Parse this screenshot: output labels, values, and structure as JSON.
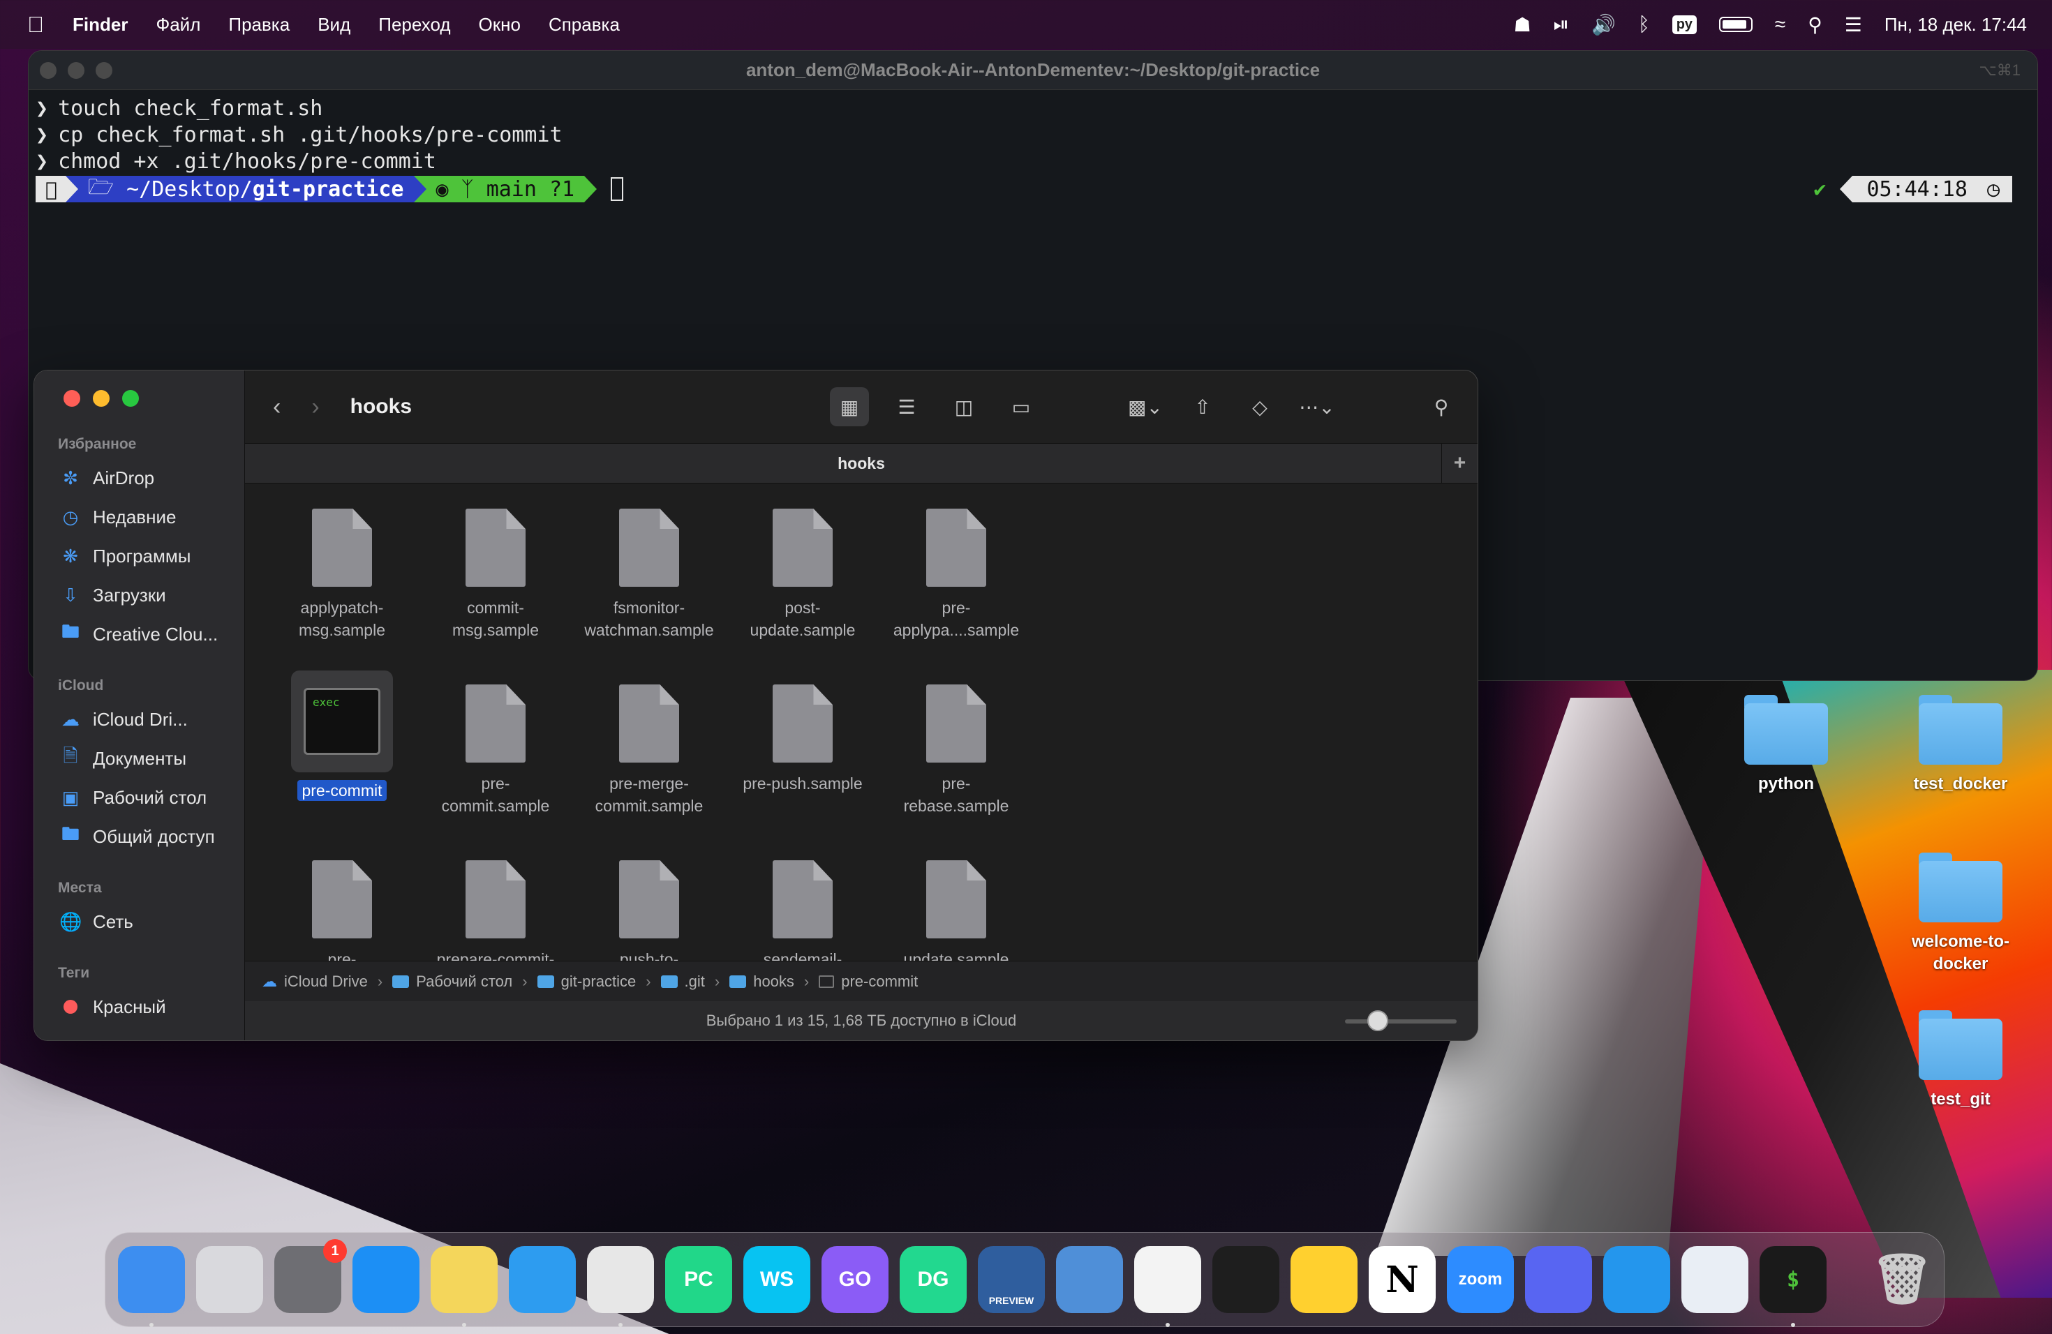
{
  "menubar": {
    "app_name": "Finder",
    "items": [
      "Файл",
      "Правка",
      "Вид",
      "Переход",
      "Окно",
      "Справка"
    ],
    "input_lang": "ру",
    "datetime": "Пн, 18 дек.  17:44"
  },
  "terminal": {
    "title": "anton_dem@MacBook-Air--AntonDementev:~/Desktop/git-practice",
    "shortcut": "⌥⌘1",
    "commands": [
      "touch check_format.sh",
      "cp check_format.sh .git/hooks/pre-commit",
      "chmod +x .git/hooks/pre-commit"
    ],
    "prompt": {
      "path_prefix": "~/Desktop/",
      "path_bold": "git-practice",
      "git": "main ?1",
      "status": "✔",
      "time": "05:44:18"
    }
  },
  "finder": {
    "title": "hooks",
    "tab_label": "hooks",
    "sidebar": {
      "favorites_header": "Избранное",
      "favorites": [
        {
          "label": "AirDrop",
          "icon": "airdrop-icon"
        },
        {
          "label": "Недавние",
          "icon": "clock-icon"
        },
        {
          "label": "Программы",
          "icon": "apps-icon"
        },
        {
          "label": "Загрузки",
          "icon": "download-icon"
        },
        {
          "label": "Creative Clou...",
          "icon": "folder-icon"
        }
      ],
      "icloud_header": "iCloud",
      "icloud": [
        {
          "label": "iCloud Dri...",
          "icon": "cloud-icon"
        },
        {
          "label": "Документы",
          "icon": "document-icon"
        },
        {
          "label": "Рабочий стол",
          "icon": "desktop-icon"
        },
        {
          "label": "Общий доступ",
          "icon": "shared-folder-icon"
        }
      ],
      "places_header": "Места",
      "places": [
        {
          "label": "Сеть",
          "icon": "network-icon"
        }
      ],
      "tags_header": "Теги",
      "tags": [
        {
          "label": "Красный",
          "color": "#ff5b5b"
        }
      ]
    },
    "files": [
      {
        "name": "applypatch-\nmsg.sample"
      },
      {
        "name": "commit-\nmsg.sample"
      },
      {
        "name": "fsmonitor-\nwatchman.sample"
      },
      {
        "name": "post-\nupdate.sample"
      },
      {
        "name": "pre-\napplypa....sample"
      },
      {
        "name": "pre-commit",
        "selected": true,
        "exec_label": "exec"
      },
      {
        "name": "pre-\ncommit.sample"
      },
      {
        "name": "pre-merge-\ncommit.sample"
      },
      {
        "name": "pre-push.sample"
      },
      {
        "name": "pre-\nrebase.sample"
      },
      {
        "name": "pre-"
      },
      {
        "name": "prepare-commit-"
      },
      {
        "name": "push-to-"
      },
      {
        "name": "sendemail-"
      },
      {
        "name": "update.sample"
      }
    ],
    "path": [
      "iCloud Drive",
      "Рабочий стол",
      "git-practice",
      ".git",
      "hooks",
      "pre-commit"
    ],
    "status": "Выбрано 1 из 15, 1,68 ТБ доступно в iCloud",
    "icon_size_fraction": 0.2
  },
  "desktop": {
    "icons": [
      "python",
      "test_docker",
      "welcome-to-\ndocker",
      "test_git"
    ]
  },
  "dock": {
    "apps": [
      {
        "name": "Finder",
        "icon": "finder-icon",
        "label": "",
        "color": "#3d8ef0",
        "running": true
      },
      {
        "name": "Launchpad",
        "icon": "launchpad-icon",
        "label": "",
        "color": "#d9d9dd",
        "running": false
      },
      {
        "name": "System Settings",
        "icon": "settings-icon",
        "label": "",
        "color": "#6e6e73",
        "running": false,
        "badge": "1"
      },
      {
        "name": "App Store",
        "icon": "appstore-icon",
        "label": "",
        "color": "#1c8ff5",
        "running": false
      },
      {
        "name": "Notes",
        "icon": "notes-icon",
        "label": "",
        "color": "#f4d65b",
        "running": true
      },
      {
        "name": "Safari",
        "icon": "safari-icon",
        "label": "",
        "color": "#2d9cf0",
        "running": false
      },
      {
        "name": "Chrome",
        "icon": "chrome-icon",
        "label": "",
        "color": "#e7e7e7",
        "running": true
      },
      {
        "name": "PyCharm",
        "icon": "pycharm-icon",
        "label": "PC",
        "color": "#21d789",
        "running": false
      },
      {
        "name": "WebStorm",
        "icon": "webstorm-icon",
        "label": "WS",
        "color": "#07c3f2",
        "running": false
      },
      {
        "name": "GoLand",
        "icon": "goland-icon",
        "label": "GO",
        "color": "#8b5cf6",
        "running": false
      },
      {
        "name": "DataGrip",
        "icon": "datagrip-icon",
        "label": "DG",
        "color": "#22d88f",
        "running": false
      },
      {
        "name": "Edge Preview",
        "icon": "edge-preview-icon",
        "label": "PREVIEW",
        "color": "#2f5e9e",
        "running": false
      },
      {
        "name": "Xcode Instruments",
        "icon": "xcode-icon",
        "label": "",
        "color": "#4f8fd8",
        "running": false
      },
      {
        "name": "VS Code",
        "icon": "vscode-icon",
        "label": "",
        "color": "#f3f3f3",
        "running": true
      },
      {
        "name": "Figma",
        "icon": "figma-icon",
        "label": "",
        "color": "#1e1e1e",
        "running": false
      },
      {
        "name": "Miro",
        "icon": "miro-icon",
        "label": "",
        "color": "#ffd02f",
        "running": false
      },
      {
        "name": "Notion",
        "icon": "notion-icon",
        "label": "N",
        "color": "#ffffff",
        "running": false
      },
      {
        "name": "Zoom",
        "icon": "zoom-icon",
        "label": "zoom",
        "color": "#2d8cff",
        "running": false
      },
      {
        "name": "Discord",
        "icon": "discord-icon",
        "label": "",
        "color": "#5865f2",
        "running": false
      },
      {
        "name": "Docker",
        "icon": "docker-icon",
        "label": "",
        "color": "#2496ed",
        "running": false
      },
      {
        "name": "VPN",
        "icon": "vpn-icon",
        "label": "",
        "color": "#e9eef5",
        "running": false
      },
      {
        "name": "Terminal",
        "icon": "terminal-icon",
        "label": "$",
        "color": "#1a1a1a",
        "running": true
      }
    ],
    "trash": {
      "name": "Trash",
      "icon": "trash-icon"
    }
  }
}
